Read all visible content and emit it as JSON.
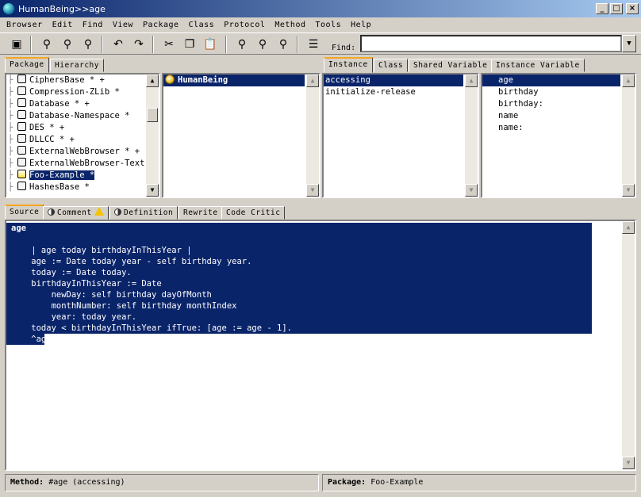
{
  "window": {
    "title": "HumanBeing>>age"
  },
  "menu": [
    "Browser",
    "Edit",
    "Find",
    "View",
    "Package",
    "Class",
    "Protocol",
    "Method",
    "Tools",
    "Help"
  ],
  "toolbar": {
    "find_label": "Find:",
    "find_value": ""
  },
  "package_tabs": [
    "Package",
    "Hierarchy"
  ],
  "packages": [
    "CiphersBase * +",
    "Compression-ZLib *",
    "Database * +",
    "Database-Namespace *",
    "DES * +",
    "DLLCC * +",
    "ExternalWebBrowser * +",
    "ExternalWebBrowser-Text",
    "Foo-Example *",
    "HashesBase *"
  ],
  "classes": [
    "HumanBeing"
  ],
  "class_tabs": [
    "Instance",
    "Class",
    "Shared Variable",
    "Instance Variable"
  ],
  "protocols": [
    "accessing",
    "initialize-release"
  ],
  "methods": [
    "age",
    "birthday",
    "birthday:",
    "name",
    "name:"
  ],
  "code_tabs": [
    "Source",
    "Comment",
    "Definition",
    "Rewrite",
    "Code Critic"
  ],
  "code_lines": [
    "age",
    "",
    "    | age today birthdayInThisYear |",
    "    age := Date today year - self birthday year.",
    "    today := Date today.",
    "    birthdayInThisYear := Date",
    "        newDay: self birthday dayOfMonth",
    "        monthNumber: self birthday monthIndex",
    "        year: today year.",
    "    today < birthdayInThisYear ifTrue: [age := age - 1].",
    "    ^age"
  ],
  "status": {
    "method_label": "Method:",
    "method_value": "#age (accessing)",
    "package_label": "Package:",
    "package_value": "Foo-Example"
  }
}
